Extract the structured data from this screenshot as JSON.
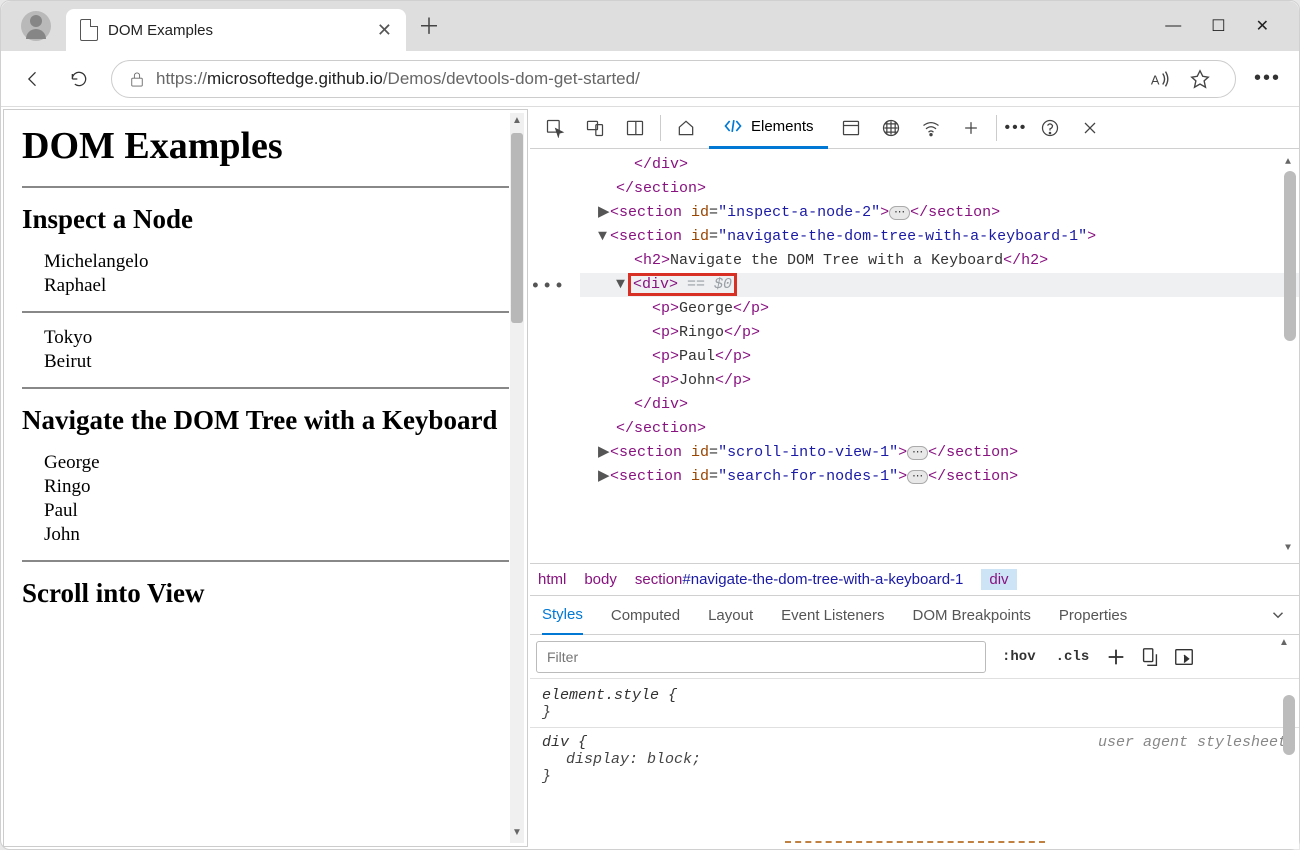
{
  "browser": {
    "tab_title": "DOM Examples",
    "url_prefix": "https://",
    "url_host": "microsoftedge.github.io",
    "url_path": "/Demos/devtools-dom-get-started/"
  },
  "page": {
    "h1": "DOM Examples",
    "sections": {
      "inspect": {
        "title": "Inspect a Node",
        "list1": [
          "Michelangelo",
          "Raphael"
        ],
        "list2": [
          "Tokyo",
          "Beirut"
        ]
      },
      "navigate": {
        "title": "Navigate the DOM Tree with a Keyboard",
        "list": [
          "George",
          "Ringo",
          "Paul",
          "John"
        ]
      },
      "scroll": {
        "title": "Scroll into View"
      }
    }
  },
  "devtools": {
    "tabs": {
      "elements": "Elements"
    },
    "dom_tree": {
      "close_div": "</div>",
      "close_section": "</section>",
      "section_inspect2": {
        "open": "<section id=\"inspect-a-node-2\">",
        "close": "</section>"
      },
      "section_nav": {
        "open_tag": "section",
        "id_attr": "id",
        "id_val": "navigate-the-dom-tree-with-a-keyboard-1"
      },
      "h2_nav": "Navigate the DOM Tree with a Keyboard",
      "selected_div": {
        "tag": "<div>",
        "eq": " == $0"
      },
      "p_items": [
        "George",
        "Ringo",
        "Paul",
        "John"
      ],
      "close_div2": "</div>",
      "close_section2": "</section>",
      "section_scroll": {
        "open": "<section id=\"scroll-into-view-1\">",
        "close": "</section>"
      },
      "section_search": {
        "open": "<section id=\"search-for-nodes-1\">",
        "close": "</section>"
      }
    },
    "breadcrumbs": [
      "html",
      "body",
      "section#navigate-the-dom-tree-with-a-keyboard-1",
      "div"
    ],
    "styles_panel": {
      "tabs": [
        "Styles",
        "Computed",
        "Layout",
        "Event Listeners",
        "DOM Breakpoints",
        "Properties"
      ],
      "filter_placeholder": "Filter",
      "hov": ":hov",
      "cls": ".cls",
      "element_style": "element.style {",
      "brace_close": "}",
      "div_rule": {
        "selector": "div {",
        "prop": "display: block;",
        "ua": "user agent stylesheet"
      }
    }
  }
}
